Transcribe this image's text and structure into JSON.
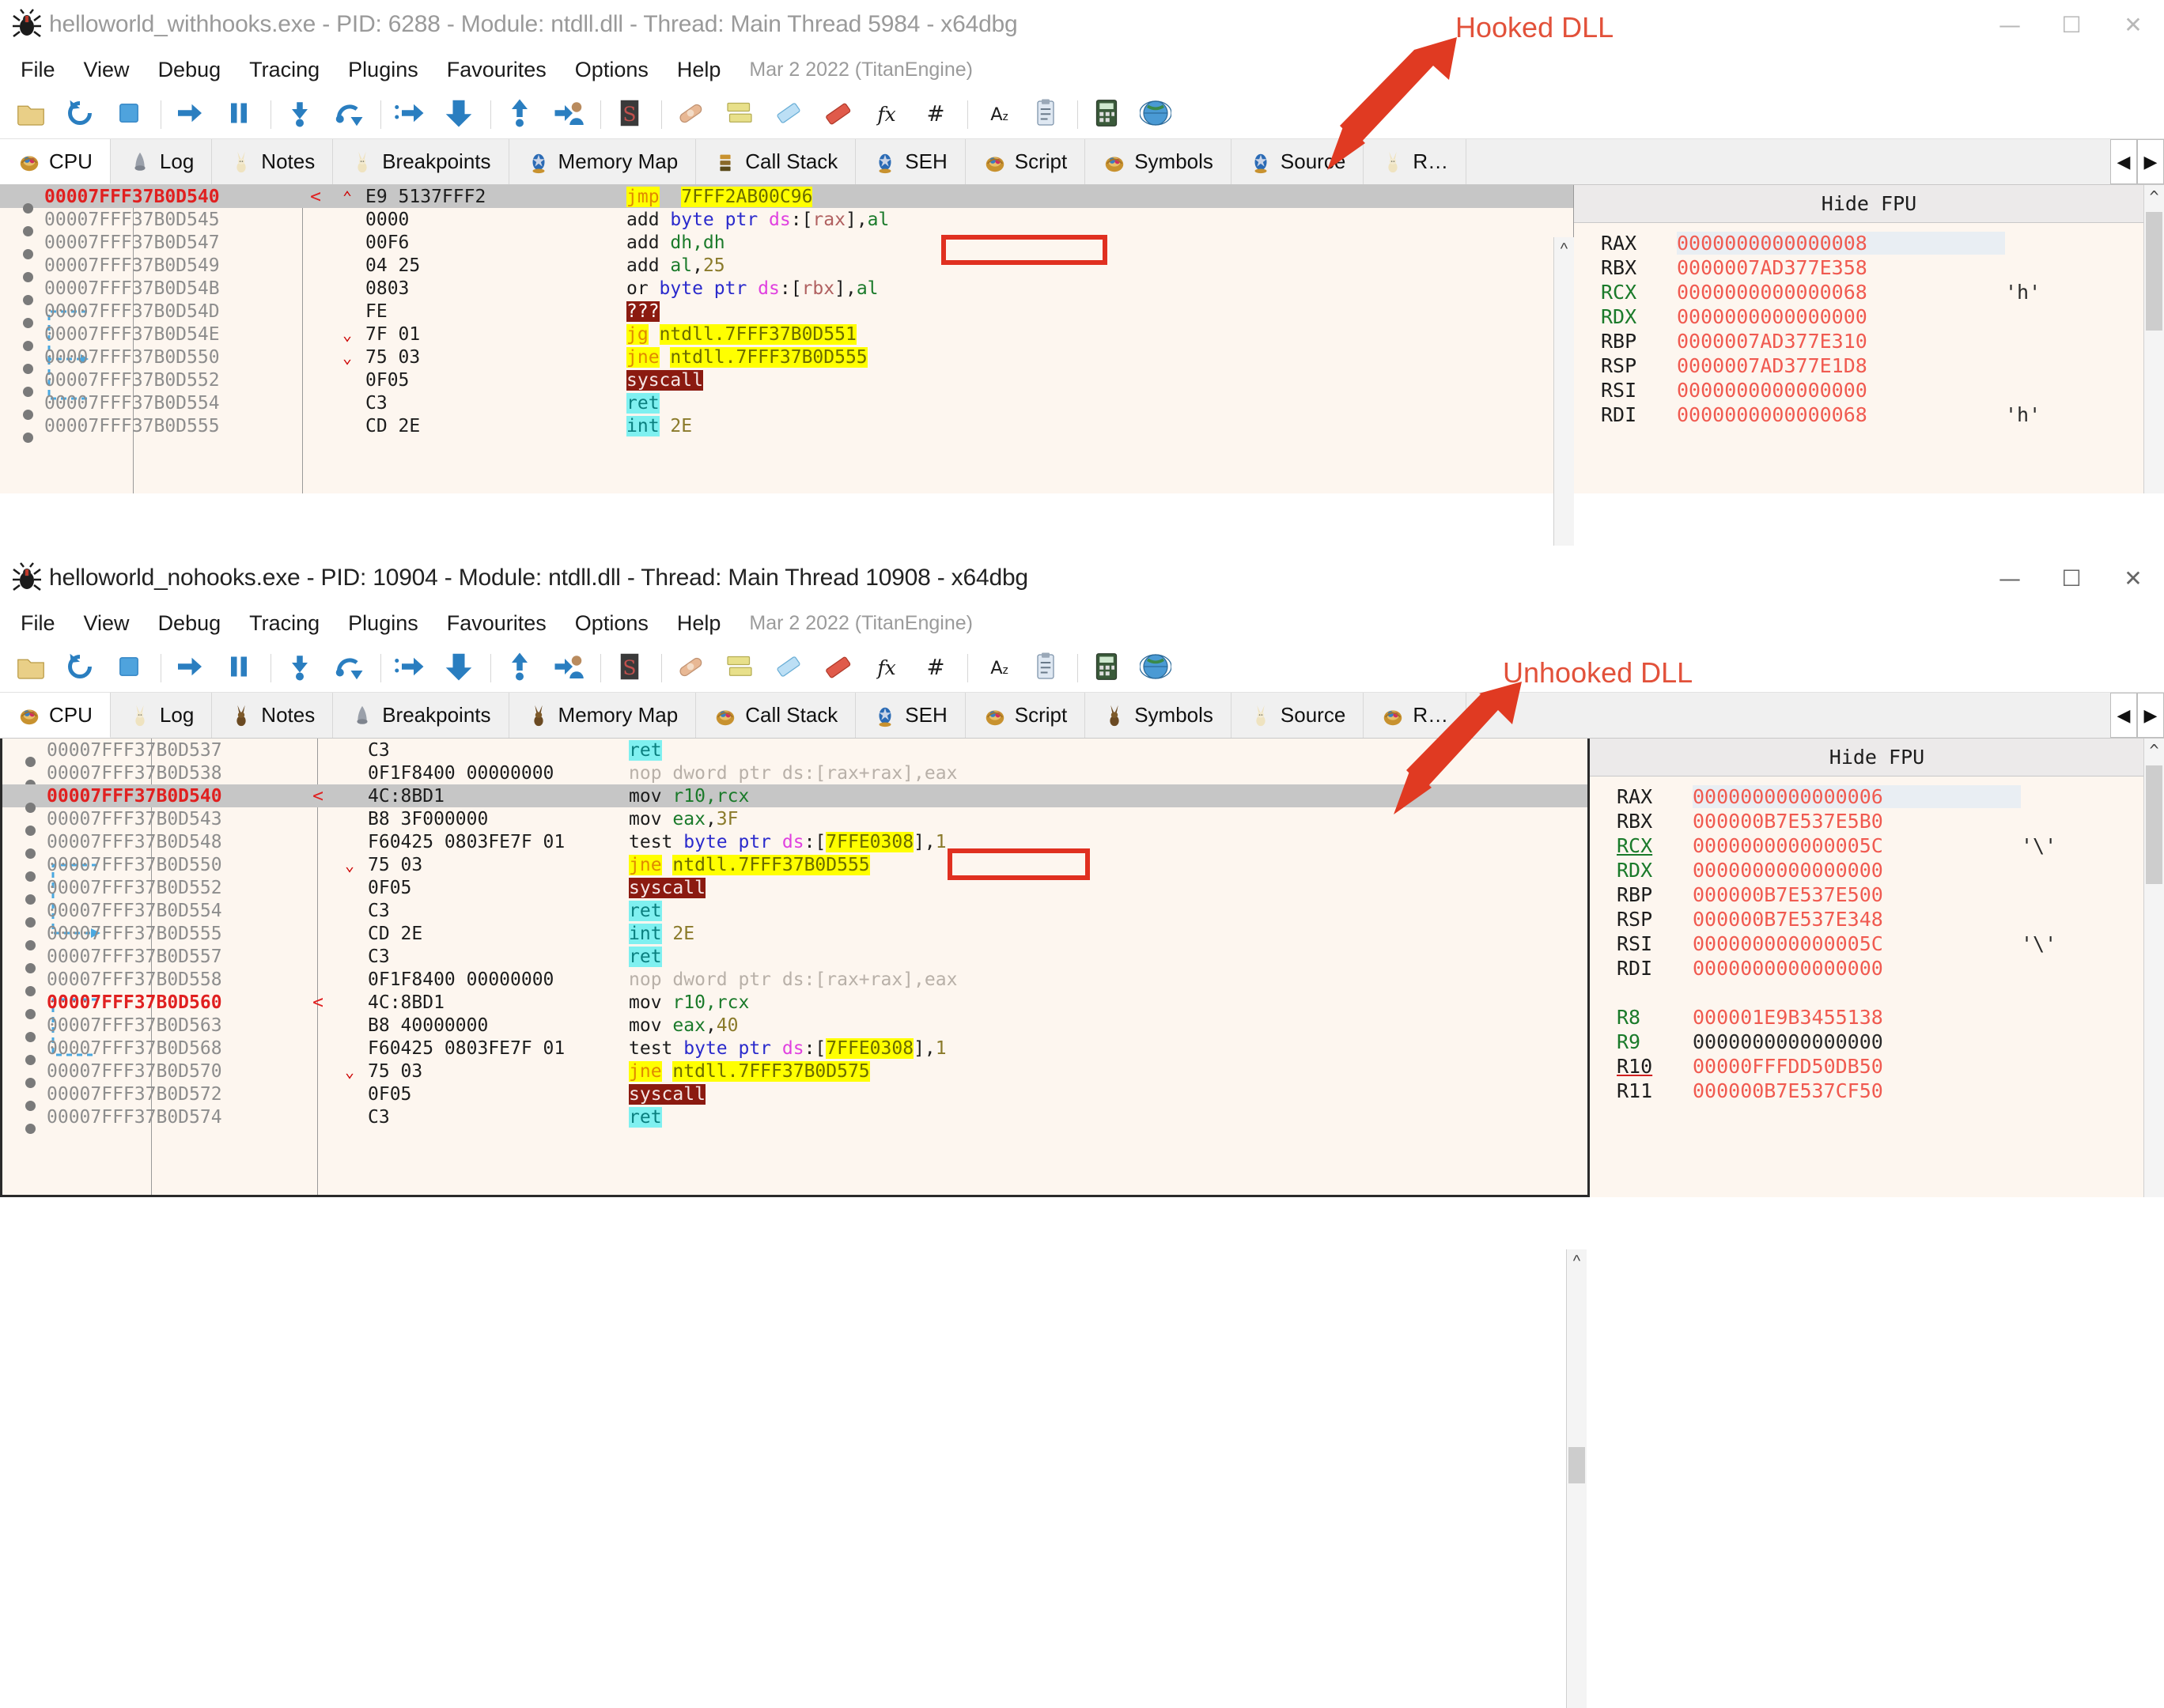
{
  "windows": [
    {
      "id": "top",
      "title": "helloworld_withhooks.exe - PID: 6288 - Module: ntdll.dll - Thread: Main Thread 5984 - x64dbg",
      "controls": {
        "minimize": "—",
        "maximize": "☐",
        "close": "✕"
      },
      "menu": [
        "File",
        "View",
        "Debug",
        "Tracing",
        "Plugins",
        "Favourites",
        "Options",
        "Help"
      ],
      "menu_note": "Mar 2 2022 (TitanEngine)",
      "tabs": [
        {
          "label": "CPU",
          "icon": "basket-icon",
          "active": true
        },
        {
          "label": "Log",
          "icon": "log-icon",
          "active": false
        },
        {
          "label": "Notes",
          "icon": "bunny-icon",
          "active": false
        },
        {
          "label": "Breakpoints",
          "icon": "bunny-icon",
          "active": false
        },
        {
          "label": "Memory Map",
          "icon": "egg-icon",
          "active": false
        },
        {
          "label": "Call Stack",
          "icon": "stack-icon",
          "active": false
        },
        {
          "label": "SEH",
          "icon": "egg-icon",
          "active": false
        },
        {
          "label": "Script",
          "icon": "basket-icon",
          "active": false
        },
        {
          "label": "Symbols",
          "icon": "basket-icon",
          "active": false
        },
        {
          "label": "Source",
          "icon": "egg-icon",
          "active": false
        },
        {
          "label": "R…",
          "icon": "bunny-icon",
          "active": false
        }
      ],
      "tab_scroll": {
        "left": "◀",
        "right": "▶"
      },
      "disasm_rows": [
        {
          "addr": "00007FFF37B0D540",
          "cur": true,
          "sel": true,
          "arrow": "<",
          "jmp": "^",
          "bytes": "E9 5137FFF2",
          "tokens": [
            {
              "t": "jmp",
              "c": "m-jmp"
            },
            {
              "t": "  ",
              "c": "m-def"
            },
            {
              "t": "7FFF2AB00C96",
              "c": "op-addr-y"
            }
          ]
        },
        {
          "addr": "00007FFF37B0D545",
          "cur": false,
          "sel": false,
          "arrow": "",
          "jmp": "",
          "bytes": "0000",
          "tokens": [
            {
              "t": "add ",
              "c": "m-def"
            },
            {
              "t": "byte ptr ",
              "c": "op-ptr"
            },
            {
              "t": "ds",
              "c": "op-seg"
            },
            {
              "t": ":[",
              "c": "op-bracket"
            },
            {
              "t": "rax",
              "c": "op-rax"
            },
            {
              "t": "],",
              "c": "op-bracket"
            },
            {
              "t": "al",
              "c": "op-reg"
            }
          ]
        },
        {
          "addr": "00007FFF37B0D547",
          "cur": false,
          "sel": false,
          "arrow": "",
          "jmp": "",
          "bytes": "00F6",
          "tokens": [
            {
              "t": "add ",
              "c": "m-def"
            },
            {
              "t": "dh,dh",
              "c": "op-reg"
            }
          ]
        },
        {
          "addr": "00007FFF37B0D549",
          "cur": false,
          "sel": false,
          "arrow": "",
          "jmp": "",
          "bytes": "04 25",
          "tokens": [
            {
              "t": "add ",
              "c": "m-def"
            },
            {
              "t": "al",
              "c": "op-reg"
            },
            {
              "t": ",",
              "c": "op-bracket"
            },
            {
              "t": "25",
              "c": "op-num"
            }
          ]
        },
        {
          "addr": "00007FFF37B0D54B",
          "cur": false,
          "sel": false,
          "arrow": "",
          "jmp": "",
          "bytes": "0803",
          "tokens": [
            {
              "t": "or ",
              "c": "m-def"
            },
            {
              "t": "byte ptr ",
              "c": "op-ptr"
            },
            {
              "t": "ds",
              "c": "op-seg"
            },
            {
              "t": ":[",
              "c": "op-bracket"
            },
            {
              "t": "rbx",
              "c": "op-rax"
            },
            {
              "t": "],",
              "c": "op-bracket"
            },
            {
              "t": "al",
              "c": "op-reg"
            }
          ]
        },
        {
          "addr": "00007FFF37B0D54D",
          "cur": false,
          "sel": false,
          "arrow": "",
          "jmp": "",
          "bytes": "FE",
          "tokens": [
            {
              "t": "???",
              "c": "m-unk"
            }
          ]
        },
        {
          "addr": "00007FFF37B0D54E",
          "cur": false,
          "sel": false,
          "arrow": "",
          "jmp": "v",
          "bytes": "7F 01",
          "tokens": [
            {
              "t": "jg",
              "c": "m-jcc"
            },
            {
              "t": " ",
              "c": "m-def"
            },
            {
              "t": "ntdll.7FFF37B0D551",
              "c": "op-addr-y"
            }
          ]
        },
        {
          "addr": "00007FFF37B0D550",
          "cur": false,
          "sel": false,
          "arrow": "",
          "jmp": "v",
          "bytes": "75 03",
          "tokens": [
            {
              "t": "jne",
              "c": "m-jcc"
            },
            {
              "t": " ",
              "c": "m-def"
            },
            {
              "t": "ntdll.7FFF37B0D555",
              "c": "op-addr-y"
            }
          ]
        },
        {
          "addr": "00007FFF37B0D552",
          "cur": false,
          "sel": false,
          "arrow": "",
          "jmp": "",
          "bytes": "0F05",
          "tokens": [
            {
              "t": "syscall",
              "c": "m-sys"
            }
          ]
        },
        {
          "addr": "00007FFF37B0D554",
          "cur": false,
          "sel": false,
          "arrow": "",
          "jmp": "",
          "bytes": "C3",
          "tokens": [
            {
              "t": "ret",
              "c": "m-ret"
            }
          ]
        },
        {
          "addr": "00007FFF37B0D555",
          "cur": false,
          "sel": false,
          "arrow": "",
          "jmp": "",
          "bytes": "CD 2E",
          "tokens": [
            {
              "t": "int",
              "c": "m-int"
            },
            {
              "t": " ",
              "c": "m-def"
            },
            {
              "t": "2E",
              "c": "op-num"
            }
          ]
        }
      ],
      "registers_header": "Hide FPU",
      "registers": [
        {
          "name": "RAX",
          "value": "0000000000000008",
          "char": "",
          "nstyle": "",
          "vstyle": "hl"
        },
        {
          "name": "RBX",
          "value": "0000007AD377E358",
          "char": "",
          "nstyle": "",
          "vstyle": ""
        },
        {
          "name": "RCX",
          "value": "0000000000000068",
          "char": "'h'",
          "nstyle": "green",
          "vstyle": ""
        },
        {
          "name": "RDX",
          "value": "0000000000000000",
          "char": "",
          "nstyle": "green",
          "vstyle": ""
        },
        {
          "name": "RBP",
          "value": "0000007AD377E310",
          "char": "",
          "nstyle": "",
          "vstyle": ""
        },
        {
          "name": "RSP",
          "value": "0000007AD377E1D8",
          "char": "",
          "nstyle": "",
          "vstyle": ""
        },
        {
          "name": "RSI",
          "value": "0000000000000000",
          "char": "",
          "nstyle": "",
          "vstyle": ""
        },
        {
          "name": "RDI",
          "value": "0000000000000068",
          "char": "'h'",
          "nstyle": "",
          "vstyle": ""
        }
      ]
    },
    {
      "id": "bottom",
      "title": "helloworld_nohooks.exe - PID: 10904 - Module: ntdll.dll - Thread: Main Thread 10908 - x64dbg",
      "controls": {
        "minimize": "—",
        "maximize": "☐",
        "close": "✕"
      },
      "menu": [
        "File",
        "View",
        "Debug",
        "Tracing",
        "Plugins",
        "Favourites",
        "Options",
        "Help"
      ],
      "menu_note": "Mar 2 2022 (TitanEngine)",
      "tabs": [
        {
          "label": "CPU",
          "icon": "basket-icon",
          "active": true
        },
        {
          "label": "Log",
          "icon": "bunny-icon",
          "active": false
        },
        {
          "label": "Notes",
          "icon": "bunny-dark-icon",
          "active": false
        },
        {
          "label": "Breakpoints",
          "icon": "log-icon",
          "active": false
        },
        {
          "label": "Memory Map",
          "icon": "bunny-dark-icon",
          "active": false
        },
        {
          "label": "Call Stack",
          "icon": "basket-icon",
          "active": false
        },
        {
          "label": "SEH",
          "icon": "egg-icon",
          "active": false
        },
        {
          "label": "Script",
          "icon": "basket-icon",
          "active": false
        },
        {
          "label": "Symbols",
          "icon": "bunny-dark-icon",
          "active": false
        },
        {
          "label": "Source",
          "icon": "bunny-icon",
          "active": false
        },
        {
          "label": "R…",
          "icon": "basket-icon",
          "active": false
        }
      ],
      "tab_scroll": {
        "left": "◀",
        "right": "▶"
      },
      "disasm_rows": [
        {
          "addr": "00007FFF37B0D537",
          "cur": false,
          "sel": false,
          "arrow": "",
          "jmp": "",
          "bytes": "C3",
          "tokens": [
            {
              "t": "ret",
              "c": "m-ret"
            }
          ]
        },
        {
          "addr": "00007FFF37B0D538",
          "cur": false,
          "sel": false,
          "arrow": "",
          "jmp": "",
          "bytes": "0F1F8400 00000000",
          "tokens": [
            {
              "t": "nop dword ptr ds:[rax+rax],eax",
              "c": "op-gray"
            }
          ]
        },
        {
          "addr": "00007FFF37B0D540",
          "cur": true,
          "sel": true,
          "arrow": "<",
          "jmp": "",
          "bytes": "4C:8BD1",
          "tokens": [
            {
              "t": "mov ",
              "c": "m-def"
            },
            {
              "t": "r10,rcx",
              "c": "op-reg"
            }
          ]
        },
        {
          "addr": "00007FFF37B0D543",
          "cur": false,
          "sel": false,
          "arrow": "",
          "jmp": "",
          "bytes": "B8 3F000000",
          "tokens": [
            {
              "t": "mov ",
              "c": "m-def"
            },
            {
              "t": "eax",
              "c": "op-reg"
            },
            {
              "t": ",",
              "c": "op-bracket"
            },
            {
              "t": "3F",
              "c": "op-num"
            }
          ]
        },
        {
          "addr": "00007FFF37B0D548",
          "cur": false,
          "sel": false,
          "arrow": "",
          "jmp": "",
          "bytes": "F60425 0803FE7F 01",
          "tokens": [
            {
              "t": "test ",
              "c": "m-def"
            },
            {
              "t": "byte ptr ",
              "c": "op-ptr"
            },
            {
              "t": "ds",
              "c": "op-seg"
            },
            {
              "t": ":[",
              "c": "op-bracket"
            },
            {
              "t": "7FFE0308",
              "c": "op-addr-y"
            },
            {
              "t": "],",
              "c": "op-bracket"
            },
            {
              "t": "1",
              "c": "op-num"
            }
          ]
        },
        {
          "addr": "00007FFF37B0D550",
          "cur": false,
          "sel": false,
          "arrow": "",
          "jmp": "v",
          "bytes": "75 03",
          "tokens": [
            {
              "t": "jne",
              "c": "m-jcc"
            },
            {
              "t": " ",
              "c": "m-def"
            },
            {
              "t": "ntdll.7FFF37B0D555",
              "c": "op-addr-y"
            }
          ]
        },
        {
          "addr": "00007FFF37B0D552",
          "cur": false,
          "sel": false,
          "arrow": "",
          "jmp": "",
          "bytes": "0F05",
          "tokens": [
            {
              "t": "syscall",
              "c": "m-sys"
            }
          ]
        },
        {
          "addr": "00007FFF37B0D554",
          "cur": false,
          "sel": false,
          "arrow": "",
          "jmp": "",
          "bytes": "C3",
          "tokens": [
            {
              "t": "ret",
              "c": "m-ret"
            }
          ]
        },
        {
          "addr": "00007FFF37B0D555",
          "cur": false,
          "sel": false,
          "arrow": "",
          "jmp": "",
          "bytes": "CD 2E",
          "tokens": [
            {
              "t": "int",
              "c": "m-int"
            },
            {
              "t": " ",
              "c": "m-def"
            },
            {
              "t": "2E",
              "c": "op-num"
            }
          ]
        },
        {
          "addr": "00007FFF37B0D557",
          "cur": false,
          "sel": false,
          "arrow": "",
          "jmp": "",
          "bytes": "C3",
          "tokens": [
            {
              "t": "ret",
              "c": "m-ret"
            }
          ]
        },
        {
          "addr": "00007FFF37B0D558",
          "cur": false,
          "sel": false,
          "arrow": "",
          "jmp": "",
          "bytes": "0F1F8400 00000000",
          "tokens": [
            {
              "t": "nop dword ptr ds:[rax+rax],eax",
              "c": "op-gray"
            }
          ]
        },
        {
          "addr": "00007FFF37B0D560",
          "cur": true,
          "sel": false,
          "arrow": "<",
          "jmp": "",
          "bytes": "4C:8BD1",
          "tokens": [
            {
              "t": "mov ",
              "c": "m-def"
            },
            {
              "t": "r10,rcx",
              "c": "op-reg"
            }
          ]
        },
        {
          "addr": "00007FFF37B0D563",
          "cur": false,
          "sel": false,
          "arrow": "",
          "jmp": "",
          "bytes": "B8 40000000",
          "tokens": [
            {
              "t": "mov ",
              "c": "m-def"
            },
            {
              "t": "eax",
              "c": "op-reg"
            },
            {
              "t": ",",
              "c": "op-bracket"
            },
            {
              "t": "40",
              "c": "op-num"
            }
          ]
        },
        {
          "addr": "00007FFF37B0D568",
          "cur": false,
          "sel": false,
          "arrow": "",
          "jmp": "",
          "bytes": "F60425 0803FE7F 01",
          "tokens": [
            {
              "t": "test ",
              "c": "m-def"
            },
            {
              "t": "byte ptr ",
              "c": "op-ptr"
            },
            {
              "t": "ds",
              "c": "op-seg"
            },
            {
              "t": ":[",
              "c": "op-bracket"
            },
            {
              "t": "7FFE0308",
              "c": "op-addr-y"
            },
            {
              "t": "],",
              "c": "op-bracket"
            },
            {
              "t": "1",
              "c": "op-num"
            }
          ]
        },
        {
          "addr": "00007FFF37B0D570",
          "cur": false,
          "sel": false,
          "arrow": "",
          "jmp": "v",
          "bytes": "75 03",
          "tokens": [
            {
              "t": "jne",
              "c": "m-jcc"
            },
            {
              "t": " ",
              "c": "m-def"
            },
            {
              "t": "ntdll.7FFF37B0D575",
              "c": "op-addr-y"
            }
          ]
        },
        {
          "addr": "00007FFF37B0D572",
          "cur": false,
          "sel": false,
          "arrow": "",
          "jmp": "",
          "bytes": "0F05",
          "tokens": [
            {
              "t": "syscall",
              "c": "m-sys"
            }
          ]
        },
        {
          "addr": "00007FFF37B0D574",
          "cur": false,
          "sel": false,
          "arrow": "",
          "jmp": "",
          "bytes": "C3",
          "tokens": [
            {
              "t": "ret",
              "c": "m-ret"
            }
          ]
        }
      ],
      "registers_header": "Hide FPU",
      "registers": [
        {
          "name": "RAX",
          "value": "0000000000000006",
          "char": "",
          "nstyle": "",
          "vstyle": "hl"
        },
        {
          "name": "RBX",
          "value": "000000B7E537E5B0",
          "char": "",
          "nstyle": "",
          "vstyle": ""
        },
        {
          "name": "RCX",
          "value": "000000000000005C",
          "char": "'\\'",
          "nstyle": "u-green",
          "vstyle": ""
        },
        {
          "name": "RDX",
          "value": "0000000000000000",
          "char": "",
          "nstyle": "green",
          "vstyle": ""
        },
        {
          "name": "RBP",
          "value": "000000B7E537E500",
          "char": "",
          "nstyle": "",
          "vstyle": ""
        },
        {
          "name": "RSP",
          "value": "000000B7E537E348",
          "char": "",
          "nstyle": "",
          "vstyle": ""
        },
        {
          "name": "RSI",
          "value": "000000000000005C",
          "char": "'\\'",
          "nstyle": "",
          "vstyle": ""
        },
        {
          "name": "RDI",
          "value": "0000000000000000",
          "char": "",
          "nstyle": "",
          "vstyle": ""
        },
        {
          "name": "",
          "value": "",
          "char": "",
          "nstyle": "",
          "vstyle": ""
        },
        {
          "name": "R8",
          "value": "000001E9B3455138",
          "char": "",
          "nstyle": "green",
          "vstyle": ""
        },
        {
          "name": "R9",
          "value": "0000000000000000",
          "char": "",
          "nstyle": "green",
          "vstyle": "black"
        },
        {
          "name": "R10",
          "value": "00000FFFDD50DB50",
          "char": "",
          "nstyle": "u-red",
          "vstyle": ""
        },
        {
          "name": "R11",
          "value": "000000B7E537CF50",
          "char": "",
          "nstyle": "",
          "vstyle": ""
        }
      ]
    }
  ],
  "annotations": [
    {
      "id": "hooked",
      "label": "Hooked DLL"
    },
    {
      "id": "unhooked",
      "label": "Unhooked DLL"
    }
  ]
}
